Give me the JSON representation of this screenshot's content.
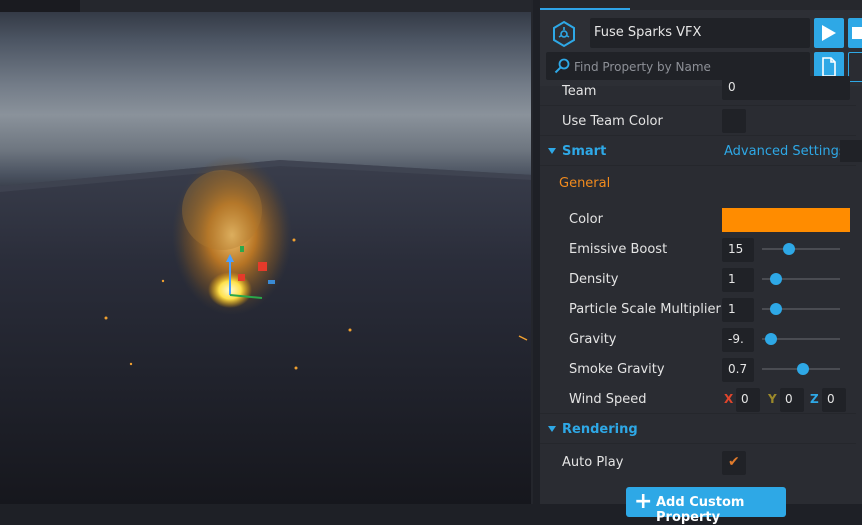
{
  "object": {
    "name": "Fuse Sparks VFX"
  },
  "search": {
    "placeholder": "Find Property by Name"
  },
  "properties": {
    "team_label": "Team",
    "team_value": "0",
    "use_team_color_label": "Use Team Color",
    "smart_section": "Smart",
    "advanced_settings": "Advanced Settings",
    "general_group": "General",
    "color_label": "Color",
    "color_value": "#ff8c00",
    "emissive_boost_label": "Emissive Boost",
    "emissive_boost_value": "15",
    "density_label": "Density",
    "density_value": "1",
    "particle_scale_label": "Particle Scale Multiplier",
    "particle_scale_value": "1",
    "gravity_label": "Gravity",
    "gravity_value": "-9.",
    "smoke_gravity_label": "Smoke Gravity",
    "smoke_gravity_value": "0.7",
    "wind_speed_label": "Wind Speed",
    "wind_x_label": "X",
    "wind_x_value": "0",
    "wind_y_label": "Y",
    "wind_y_value": "0",
    "wind_z_label": "Z",
    "wind_z_value": "0",
    "rendering_section": "Rendering",
    "auto_play_label": "Auto Play",
    "auto_play_checked": true
  },
  "sliders": {
    "emissive_boost": 0.35,
    "density": 0.18,
    "particle_scale": 0.18,
    "gravity": 0.12,
    "smoke_gravity": 0.53
  },
  "add_custom_property": "Add Custom Property",
  "colors": {
    "accent": "#2ea8e6",
    "orange": "#f28b1d",
    "panel": "#2a2c32"
  }
}
